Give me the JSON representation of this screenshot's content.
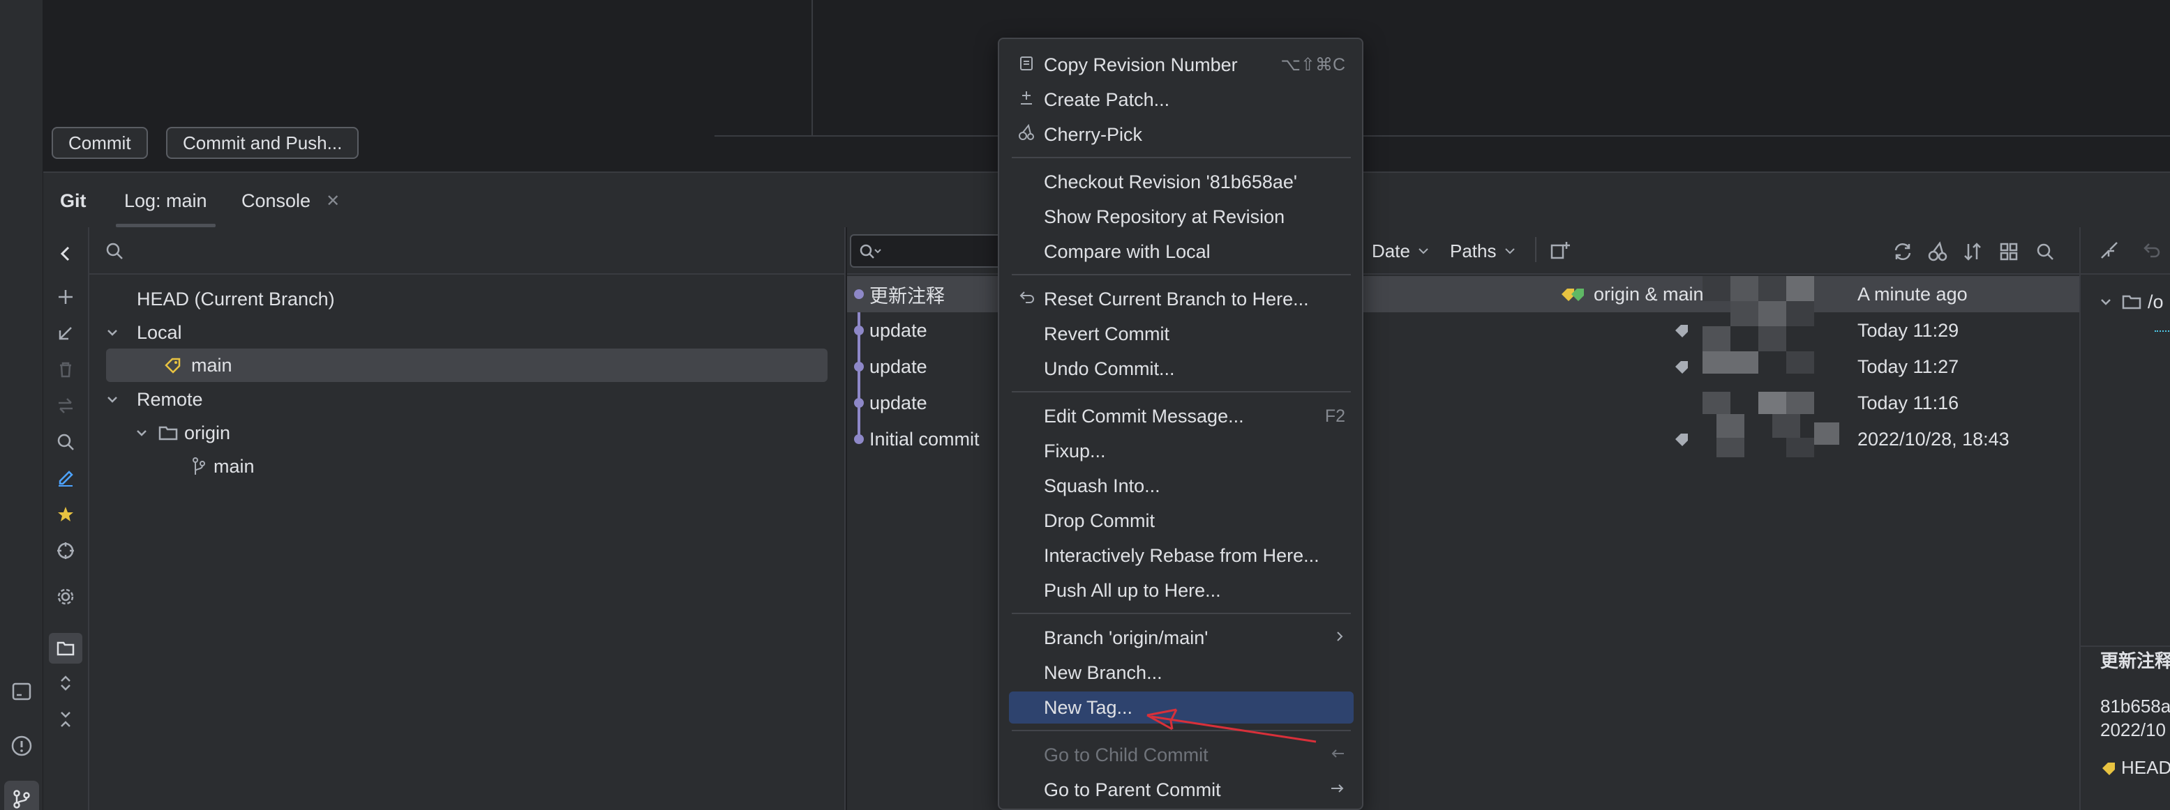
{
  "top": {
    "commit_label": "Commit",
    "commit_push_label": "Commit and Push..."
  },
  "tabs": {
    "git": "Git",
    "log": "Log: main",
    "console": "Console"
  },
  "branches": {
    "head": "HEAD (Current Branch)",
    "local": "Local",
    "local_main": "main",
    "remote": "Remote",
    "origin": "origin",
    "origin_main": "main"
  },
  "log_toolbar": {
    "date": "Date",
    "paths": "Paths"
  },
  "commits": [
    {
      "message": "更新注释",
      "refs": "origin & main",
      "time": "A minute ago"
    },
    {
      "message": "update",
      "refs": "",
      "time": "Today 11:29"
    },
    {
      "message": "update",
      "refs": "",
      "time": "Today 11:27"
    },
    {
      "message": "update",
      "refs": "",
      "time": "Today 11:16"
    },
    {
      "message": "Initial commit",
      "refs": "",
      "time": "2022/10/28, 18:43"
    }
  ],
  "details": {
    "path": "/o",
    "msg": "更新注释",
    "hash": "81b658a",
    "date": "2022/10",
    "head": "HEAD"
  },
  "menu": {
    "copy_revision": "Copy Revision Number",
    "copy_revision_sc": "⌥⇧⌘C",
    "create_patch": "Create Patch...",
    "cherry_pick": "Cherry-Pick",
    "checkout_revision": "Checkout Revision '81b658ae'",
    "show_repo": "Show Repository at Revision",
    "compare_local": "Compare with Local",
    "reset_branch": "Reset Current Branch to Here...",
    "revert_commit": "Revert Commit",
    "undo_commit": "Undo Commit...",
    "edit_message": "Edit Commit Message...",
    "edit_message_sc": "F2",
    "fixup": "Fixup...",
    "squash": "Squash Into...",
    "drop": "Drop Commit",
    "rebase": "Interactively Rebase from Here...",
    "push_all": "Push All up to Here...",
    "branch_origin": "Branch 'origin/main'",
    "new_branch": "New Branch...",
    "new_tag": "New Tag...",
    "go_child": "Go to Child Commit",
    "go_parent": "Go to Parent Commit"
  },
  "colors": {
    "highlight": "#2e436e",
    "graph": "#8e88c8",
    "annotation_arrow": "#d8303a",
    "tag_yellow": "#e8c341"
  }
}
